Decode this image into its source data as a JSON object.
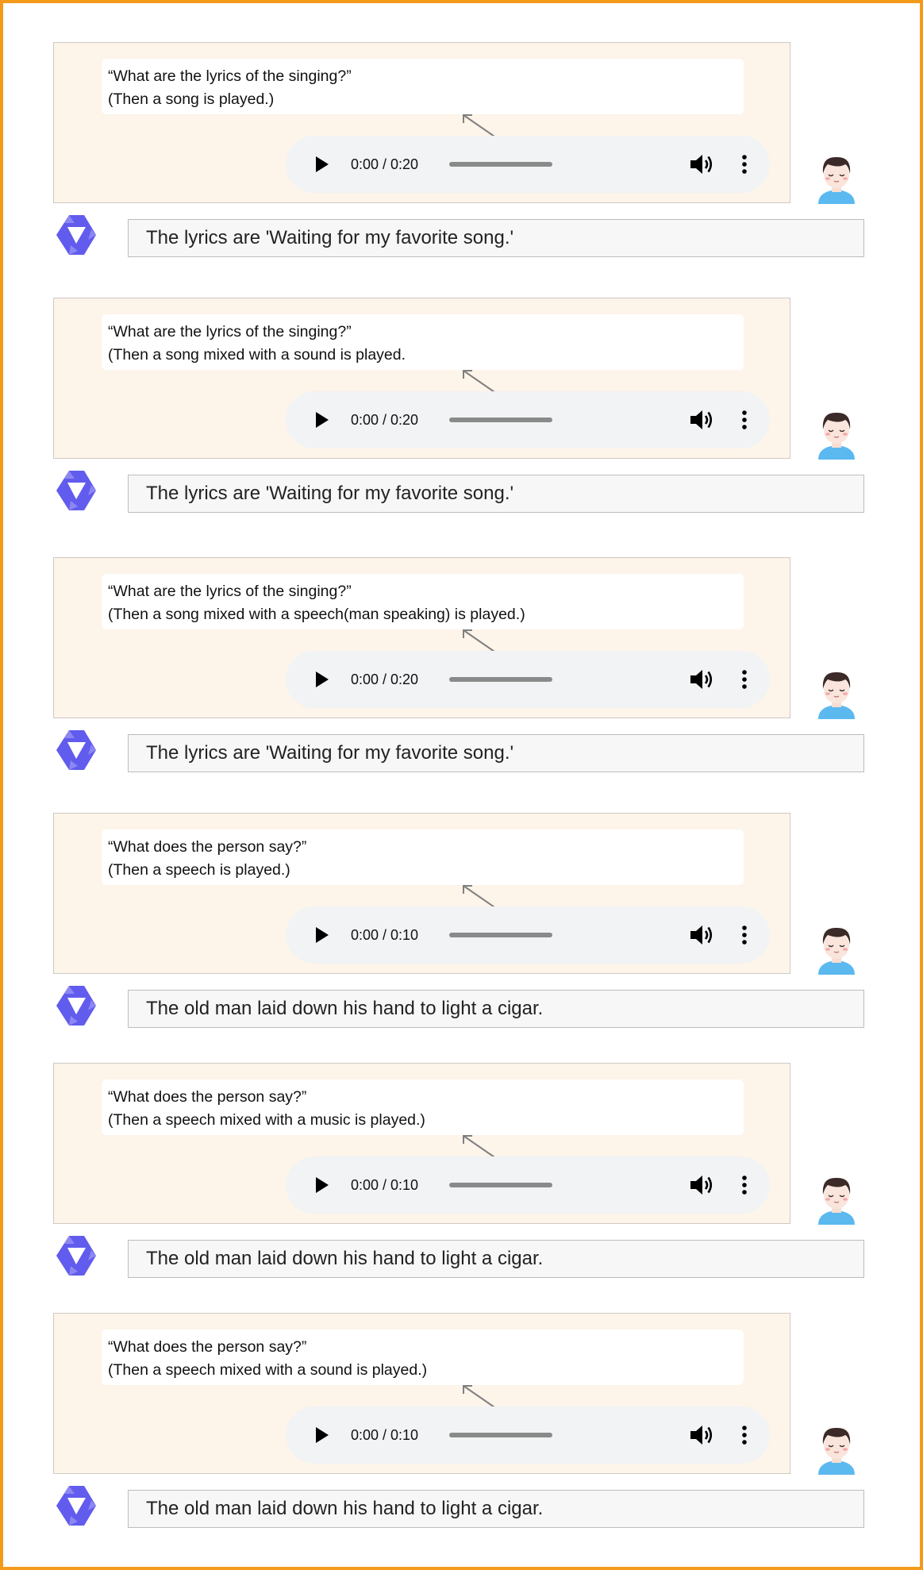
{
  "colors": {
    "frame_border": "#f39a1b",
    "user_panel_bg": "#fdf4ea",
    "player_bg": "#f1f3f4",
    "bot_logo": "#615ced",
    "avatar_shirt": "#5bb9f0"
  },
  "icons": {
    "play": "play-icon",
    "volume": "volume-icon",
    "menu": "more-vertical-icon",
    "user_avatar": "user-avatar-icon",
    "bot_logo": "qwen-logo-icon",
    "arrow": "arrow-up-left-icon"
  },
  "turns": [
    {
      "question": "“What are the lyrics of the singing?”",
      "context": "(Then a song is played.)",
      "audio": {
        "time": "0:00 / 0:20",
        "progress": 0
      },
      "answer": "The lyrics are 'Waiting for my favorite song.'"
    },
    {
      "question": "“What are the lyrics of the singing?”",
      "context": "(Then a song mixed with a sound is played.",
      "audio": {
        "time": "0:00 / 0:20",
        "progress": 0
      },
      "answer": "The lyrics are 'Waiting for my favorite song.'"
    },
    {
      "question": "“What are the lyrics of the singing?”",
      "context": "(Then a song mixed with a speech(man speaking) is played.)",
      "audio": {
        "time": "0:00 / 0:20",
        "progress": 0
      },
      "answer": "The lyrics are 'Waiting for my favorite song.'"
    },
    {
      "question": "“What does the person say?”",
      "context": "(Then a speech is played.)",
      "audio": {
        "time": "0:00 / 0:10",
        "progress": 0
      },
      "answer": "The old man laid down his hand to light a cigar."
    },
    {
      "question": "“What does the person say?”",
      "context": "(Then a speech mixed with a music is played.)",
      "audio": {
        "time": "0:00 / 0:10",
        "progress": 0
      },
      "answer": "The old man laid down his hand to light a cigar."
    },
    {
      "question": "“What does the person say?”",
      "context": "(Then a speech mixed with a sound is played.)",
      "audio": {
        "time": "0:00 / 0:10",
        "progress": 0
      },
      "answer": "The old man laid down his hand to light a cigar."
    }
  ]
}
